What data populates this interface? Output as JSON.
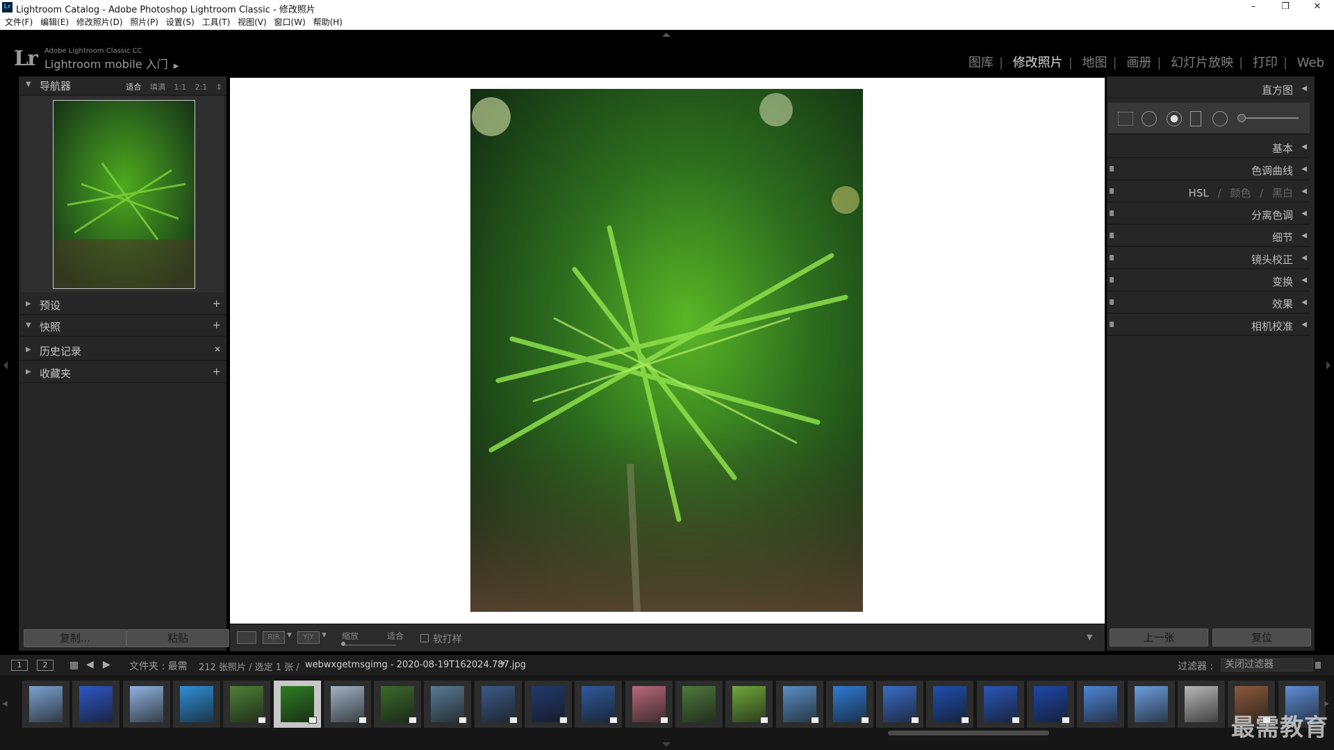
{
  "window": {
    "title": "Lightroom Catalog - Adobe Photoshop Lightroom Classic - 修改照片",
    "app_badge": "Lr",
    "minimize": "–",
    "restore": "❐",
    "close": "✕"
  },
  "menu": [
    "文件(F)",
    "编辑(E)",
    "修改照片(D)",
    "照片(P)",
    "设置(S)",
    "工具(T)",
    "视图(V)",
    "窗口(W)",
    "帮助(H)"
  ],
  "header": {
    "logo": "Lr",
    "product_name": "Adobe Lightroom Classic CC",
    "mobile_label": "Lightroom mobile 入门",
    "mobile_arrow": "▶",
    "modules": [
      "图库",
      "修改照片",
      "地图",
      "画册",
      "幻灯片放映",
      "打印",
      "Web"
    ],
    "active_module": "修改照片"
  },
  "left_panel": {
    "navigator": {
      "label": "导航器",
      "zoom_options": [
        "适合",
        "填满",
        "1:1",
        "2:1"
      ],
      "selected_zoom": "适合",
      "zoom_menu_icon": "⇕"
    },
    "sections": [
      {
        "label": "预设",
        "action": "+",
        "expanded": false
      },
      {
        "label": "快照",
        "action": "+",
        "expanded": true
      },
      {
        "label": "历史记录",
        "action": "✕",
        "expanded": false
      },
      {
        "label": "收藏夹",
        "action": "+",
        "expanded": false
      }
    ],
    "copy_button": "复制...",
    "paste_button": "粘贴"
  },
  "toolbar": {
    "view_icon_2": "R|R",
    "view_icon_3": "Y|Y",
    "zoom_label": "缩放",
    "zoom_value": "适合",
    "soft_proof_label": "软打样",
    "soft_proof_checked": false,
    "toolbar_menu_icon": "▼"
  },
  "right_panel": {
    "histogram_label": "直方图",
    "basic_label": "基本",
    "sections": [
      "色调曲线",
      "分离色调",
      "细节",
      "镜头校正",
      "变换",
      "效果",
      "相机校准"
    ],
    "hsl": {
      "hsl": "HSL",
      "color": "颜色",
      "bw": "黑白",
      "sep": "/"
    },
    "prev_button": "上一张",
    "reset_button": "复位"
  },
  "filmstrip_bar": {
    "page1": "1",
    "page2": "2",
    "source_prefix": "文件夹 : 最需",
    "count": "212 张照片 / 选定 1 张 /",
    "filename": "webwxgetmsgimg - 2020-08-19T162024.787.jpg",
    "dropdown_icon": "▼",
    "filter_label": "过滤器 :",
    "filter_value": "关闭过滤器"
  },
  "filmstrip": {
    "selected_index": 5,
    "thumbs": [
      {
        "color": "#7ba2cf",
        "badge": false
      },
      {
        "color": "#2f57c4",
        "badge": false
      },
      {
        "color": "#8fb1dd",
        "badge": false
      },
      {
        "color": "#2f8fd6",
        "badge": false
      },
      {
        "color": "#4e7f36",
        "badge": true
      },
      {
        "color": "#2e7d22",
        "badge": true
      },
      {
        "color": "#9fb2c4",
        "badge": true
      },
      {
        "color": "#3c6a2c",
        "badge": true
      },
      {
        "color": "#587a93",
        "badge": true
      },
      {
        "color": "#3d5a85",
        "badge": true
      },
      {
        "color": "#223a6e",
        "badge": true
      },
      {
        "color": "#2f5a9c",
        "badge": true
      },
      {
        "color": "#b86a7a",
        "badge": true
      },
      {
        "color": "#4d7a3c",
        "badge": false
      },
      {
        "color": "#6fa83a",
        "badge": true
      },
      {
        "color": "#5a8fc5",
        "badge": true
      },
      {
        "color": "#2f7cd5",
        "badge": true
      },
      {
        "color": "#3a6cc5",
        "badge": true
      },
      {
        "color": "#1f4fb0",
        "badge": true
      },
      {
        "color": "#2a56b8",
        "badge": true
      },
      {
        "color": "#1d47a8",
        "badge": true
      },
      {
        "color": "#4f86d6",
        "badge": false
      },
      {
        "color": "#6b9ee0",
        "badge": false
      },
      {
        "color": "#b8b8b8",
        "badge": false
      },
      {
        "color": "#8a5a3a",
        "badge": true
      },
      {
        "color": "#5e8fd8",
        "badge": false
      }
    ]
  },
  "watermark": "最需教育",
  "colors": {
    "app_bg": "#000000",
    "panel_bg": "#262626",
    "canvas_bg": "#ffffff",
    "active_module": "#dcdcdc",
    "inactive_module": "#7f7f7f"
  }
}
